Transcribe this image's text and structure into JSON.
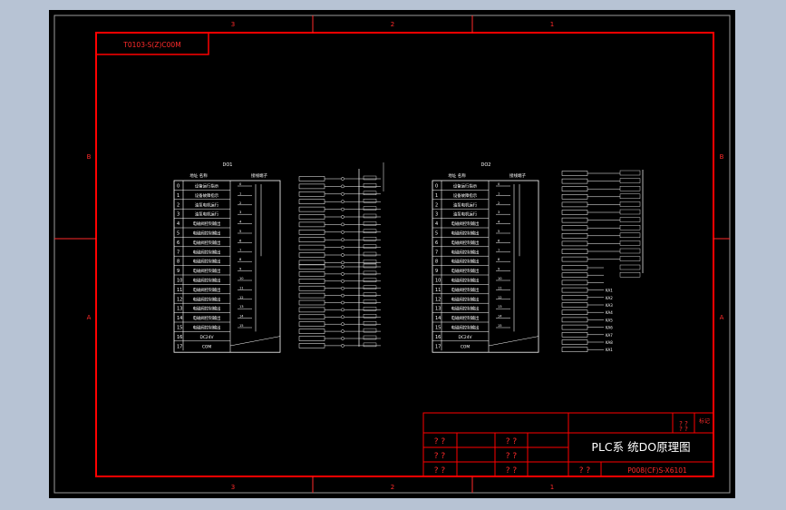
{
  "drawing": {
    "top_tag": "T0103-S(Z)C00M",
    "zone_columns": [
      "3",
      "2",
      "1"
    ],
    "zone_rows": [
      "B",
      "A"
    ],
    "panels": [
      {
        "title": "DO1",
        "left_header": "地址 名称",
        "right_header": "接线端子",
        "rows": [
          "0",
          "1",
          "2",
          "3",
          "4",
          "5",
          "6",
          "7",
          "8",
          "9",
          "10",
          "11",
          "12",
          "13",
          "14",
          "15",
          "16",
          "17"
        ],
        "labels": [
          "设备运行指示",
          "设备故障指示",
          "油泵电机运行",
          "油泵电机运行",
          "电磁阀控制输出",
          "电磁阀控制输出",
          "电磁阀控制输出",
          "电磁阀控制输出",
          "电磁阀控制输出",
          "电磁阀控制输出",
          "电磁阀控制输出",
          "电磁阀控制输出",
          "电磁阀控制输出",
          "电磁阀控制输出",
          "电磁阀控制输出",
          "电磁阀控制输出",
          "DC24V",
          "COM"
        ]
      },
      {
        "title": "DO2",
        "left_header": "地址 名称",
        "right_header": "接线端子",
        "rows": [
          "0",
          "1",
          "2",
          "3",
          "4",
          "5",
          "6",
          "7",
          "8",
          "9",
          "10",
          "11",
          "12",
          "13",
          "14",
          "15",
          "16",
          "17"
        ],
        "labels": [
          "设备运行指示",
          "设备故障指示",
          "油泵电机运行",
          "油泵电机运行",
          "电磁阀控制输出",
          "电磁阀控制输出",
          "电磁阀控制输出",
          "电磁阀控制输出",
          "电磁阀控制输出",
          "电磁阀控制输出",
          "电磁阀控制输出",
          "电磁阀控制输出",
          "电磁阀控制输出",
          "电磁阀控制输出",
          "电磁阀控制输出",
          "电磁阀控制输出",
          "DC24V",
          "COM"
        ]
      }
    ],
    "relay_labels": [
      "KA1",
      "KA2",
      "KA3",
      "KA4",
      "KA5",
      "KA6",
      "KA7",
      "KA8"
    ],
    "title_block": {
      "drawing_title": "PLC系 统DO原理图",
      "drawing_number": "P008(CF)S-X6101",
      "placeholder": "? ?",
      "corner_text": "标记"
    },
    "colors": {
      "background": "#000000",
      "frame": "#ff0000",
      "wiring": "#ffffff",
      "outer_page": "#b7c3d4",
      "border_marks": "#ff2a2a"
    }
  }
}
